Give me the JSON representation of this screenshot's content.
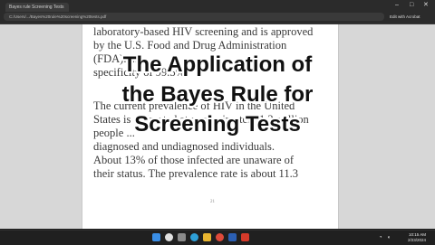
{
  "browser": {
    "tab_title": "Bayes rule Screening Tests",
    "url": "C:/Users/.../Bayes%20rule%20screening%20tests.pdf",
    "right_label": "Edit with Acrobat",
    "minimize_glyph": "–",
    "maximize_glyph": "□",
    "close_glyph": "✕"
  },
  "document": {
    "lines": [
      "laboratory-based HIV screening and is approved",
      "by the U.S. Food and Drug Administration",
      "(FDA). ...",
      "specificity of 99.5%.",
      "",
      "The current prevalence of HIV in the United",
      "States is estimated at approximately 1.2 million",
      "people ...",
      "diagnosed and undiagnosed individuals.",
      "About 13% of those infected are unaware of",
      "their status. The prevalence rate is about 11.3"
    ],
    "page_number": "21"
  },
  "overlay": {
    "line1": "The Application  of",
    "line2": "the Bayes Rule for",
    "line3": "Screening Tests"
  },
  "taskbar": {
    "time": "10:15 AM",
    "date": "2/23/2024",
    "icons": [
      "start-icon",
      "search-icon",
      "task-view-icon",
      "edge-icon",
      "explorer-icon",
      "chrome-icon",
      "word-icon",
      "acrobat-icon"
    ],
    "colors": {
      "start": "#3a8ee6",
      "search": "#e0e0e0",
      "task_view": "#8a8a8a",
      "edge": "#2ea0d8",
      "explorer": "#e8b530",
      "chrome": "#de4a3a",
      "word": "#2b5fb3",
      "acrobat": "#d63a2a"
    }
  }
}
